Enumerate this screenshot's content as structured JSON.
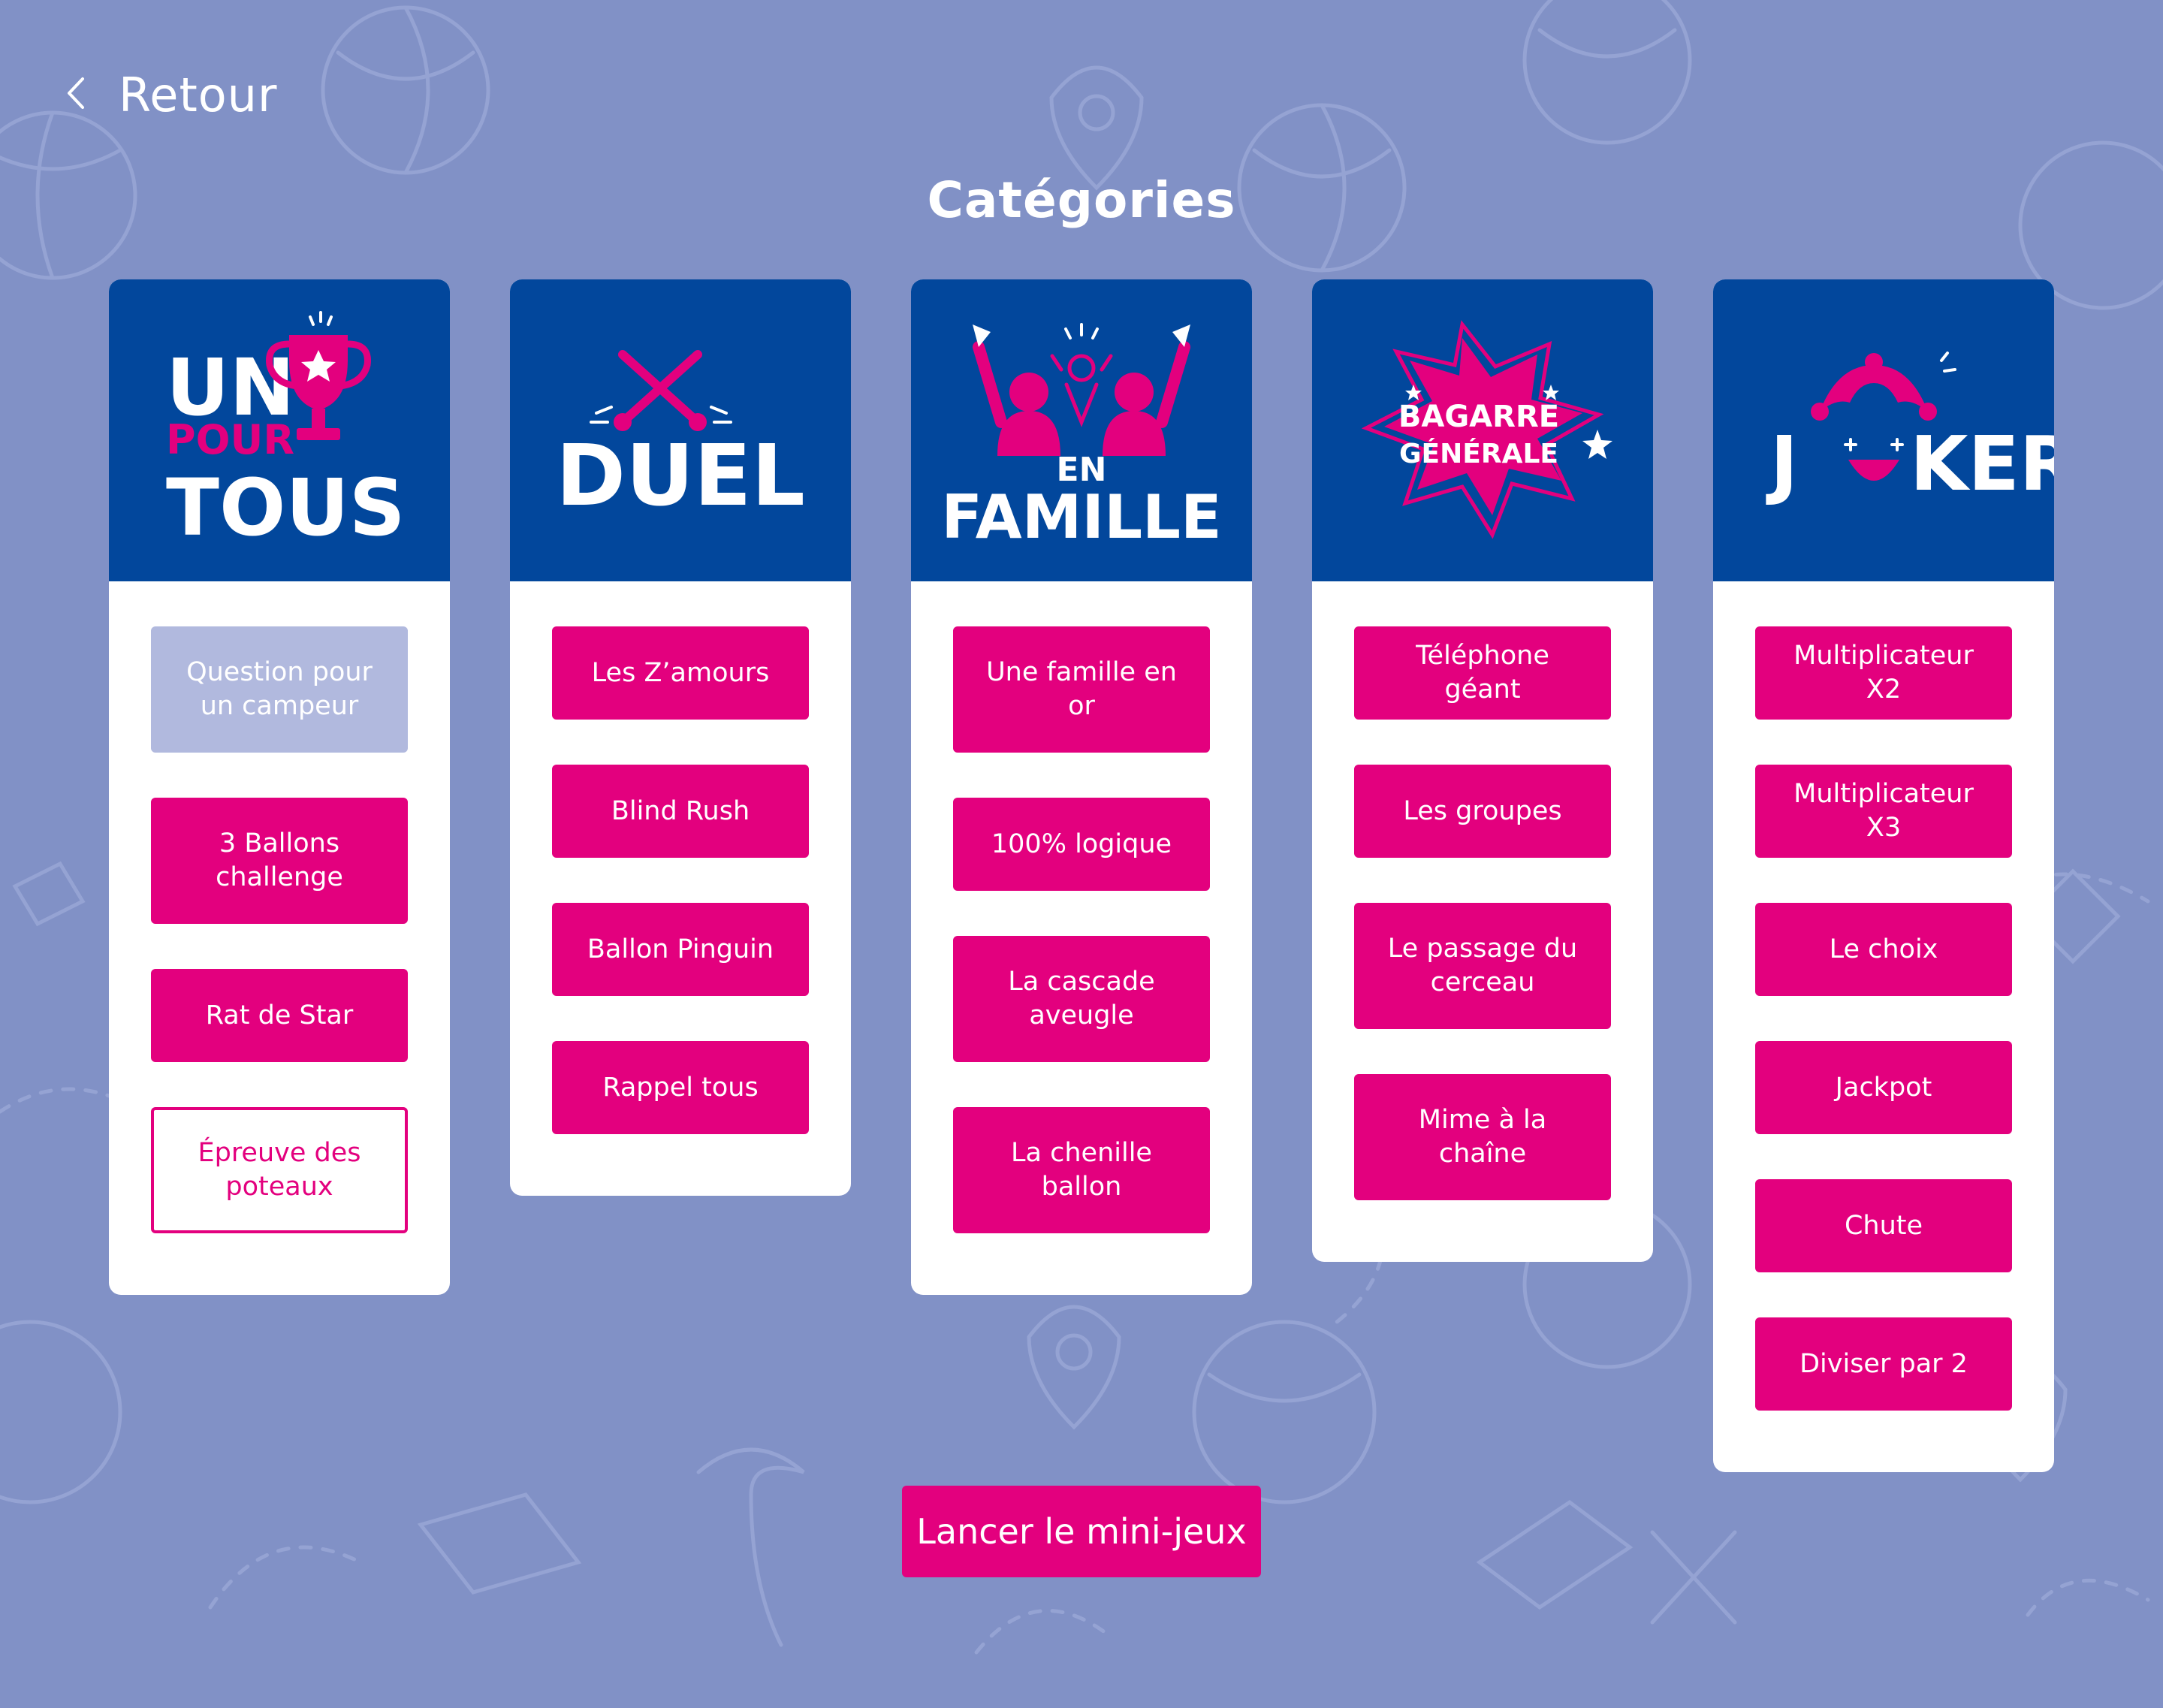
{
  "nav": {
    "back_label": "Retour",
    "back_icon": "chevron-left-icon"
  },
  "page": {
    "title": "Catégories"
  },
  "colors": {
    "background": "#8191c6",
    "header": "#02479c",
    "accent": "#e3007e",
    "disabled": "#b1b9de"
  },
  "categories": [
    {
      "logo": {
        "line1": "UN",
        "line2": "POUR",
        "line3": "TOUS",
        "icon": "trophy-icon"
      },
      "items": [
        {
          "label": "Question pour un campeur",
          "state": "disabled"
        },
        {
          "label": "3 Ballons challenge",
          "state": "active"
        },
        {
          "label": "Rat de Star",
          "state": "active"
        },
        {
          "label": "Épreuve des poteaux",
          "state": "outlined"
        }
      ]
    },
    {
      "logo": {
        "text": "DUEL",
        "icon": "crossed-swords-icon"
      },
      "items": [
        {
          "label": "Les Z’amours",
          "state": "active"
        },
        {
          "label": "Blind Rush",
          "state": "active"
        },
        {
          "label": "Ballon Pinguin",
          "state": "active"
        },
        {
          "label": "Rappel tous",
          "state": "active"
        }
      ]
    },
    {
      "logo": {
        "line1": "EN",
        "line2": "FAMILLE",
        "icon": "cheering-family-icon"
      },
      "items": [
        {
          "label": "Une famille en or",
          "state": "active"
        },
        {
          "label": "100% logique",
          "state": "active"
        },
        {
          "label": "La cascade aveugle",
          "state": "active"
        },
        {
          "label": "La chenille ballon",
          "state": "active"
        }
      ]
    },
    {
      "logo": {
        "line1": "BAGARRE",
        "line2": "GÉNÉRALE",
        "icon": "explosion-star-icon"
      },
      "items": [
        {
          "label": "Téléphone géant",
          "state": "active"
        },
        {
          "label": "Les groupes",
          "state": "active"
        },
        {
          "label": "Le passage du cerceau",
          "state": "active"
        },
        {
          "label": "Mime à la chaîne",
          "state": "active"
        }
      ]
    },
    {
      "logo": {
        "first": "J",
        "rest": "KER",
        "icon": "jester-hat-icon"
      },
      "items": [
        {
          "label": "Multiplicateur X2",
          "state": "active"
        },
        {
          "label": "Multiplicateur X3",
          "state": "active"
        },
        {
          "label": "Le choix",
          "state": "active"
        },
        {
          "label": "Jackpot",
          "state": "active"
        },
        {
          "label": "Chute",
          "state": "active"
        },
        {
          "label": "Diviser par 2",
          "state": "active"
        }
      ]
    }
  ],
  "footer": {
    "launch_label": "Lancer le mini-jeux"
  }
}
